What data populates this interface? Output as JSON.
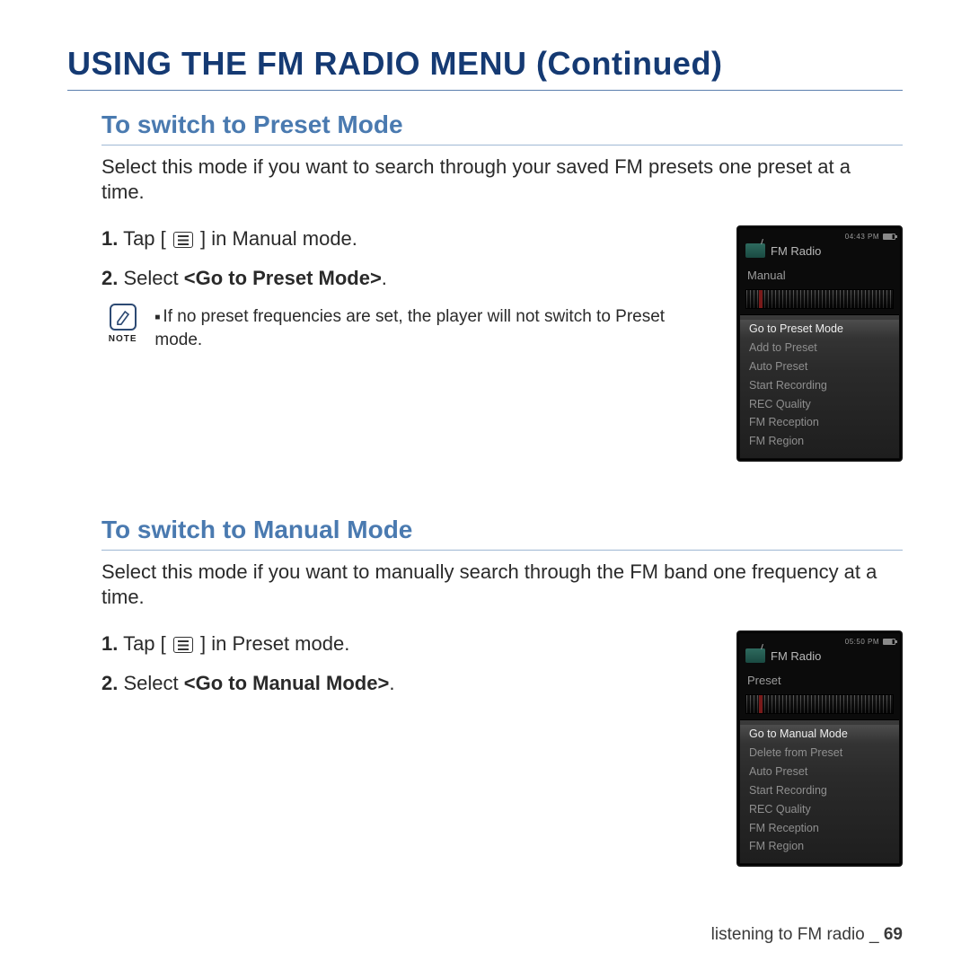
{
  "title": "USING THE FM RADIO MENU (Continued)",
  "section1": {
    "heading": "To switch to Preset Mode",
    "intro": "Select this mode if you want to search through your saved FM presets one preset at a time.",
    "step1_num": "1.",
    "step1_a": " Tap ",
    "step1_b": "[ ",
    "step1_c": " ]",
    "step1_d": " in Manual mode.",
    "step2_num": "2.",
    "step2_a": " Select ",
    "step2_bold": "<Go to Preset Mode>",
    "step2_end": ".",
    "note_label": "NOTE",
    "note_text": "If no preset frequencies are set, the player will not switch to Preset mode."
  },
  "section2": {
    "heading": "To switch to Manual Mode",
    "intro": "Select this mode if you want to manually search through the FM band one frequency at a time.",
    "step1_num": "1.",
    "step1_a": " Tap ",
    "step1_b": "[ ",
    "step1_c": " ]",
    "step1_d": " in Preset mode.",
    "step2_num": "2.",
    "step2_a": " Select ",
    "step2_bold": "<Go to Manual Mode>",
    "step2_end": "."
  },
  "device1": {
    "time": "04:43 PM",
    "title": "FM Radio",
    "mode": "Manual",
    "options": [
      "Go to Preset Mode",
      "Add to Preset",
      "Auto Preset",
      "Start Recording",
      "REC Quality",
      "FM Reception",
      "FM Region"
    ]
  },
  "device2": {
    "time": "05:50 PM",
    "title": "FM Radio",
    "mode": "Preset",
    "options": [
      "Go to Manual Mode",
      "Delete from Preset",
      "Auto Preset",
      "Start Recording",
      "REC Quality",
      "FM Reception",
      "FM Region"
    ]
  },
  "footer": {
    "text": "listening to FM radio _ ",
    "page": "69"
  }
}
